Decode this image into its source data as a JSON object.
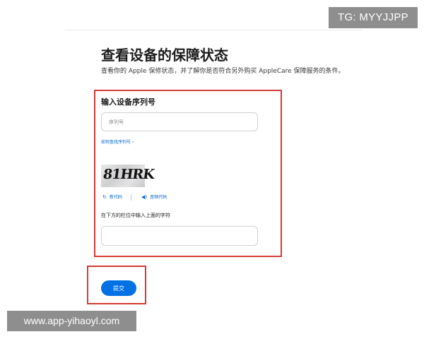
{
  "watermarks": {
    "telegram": "TG: MYYJJPP",
    "site": "www.app-yihaoyl.com"
  },
  "page": {
    "title": "查看设备的保障状态",
    "subtitle": "查看你的 Apple 保修状态，并了解你是否符合另外购买 AppleCare 保障服务的条件。"
  },
  "form": {
    "section_title": "输入设备序列号",
    "serial_placeholder": "序列号",
    "find_serial_link": "如何查找序列号 ›",
    "captcha_text": "81HRK",
    "refresh_label": "新代码",
    "audio_label": "音频代码",
    "captcha_prompt": "在下方的栏位中输入上面的字符",
    "submit_label": "提交"
  },
  "icons": {
    "refresh": "refresh-icon",
    "audio": "speaker-icon"
  },
  "colors": {
    "accent": "#0071e3",
    "link": "#0066cc",
    "highlight_border": "#d43a34",
    "watermark_bg": "#8e8e8e"
  }
}
